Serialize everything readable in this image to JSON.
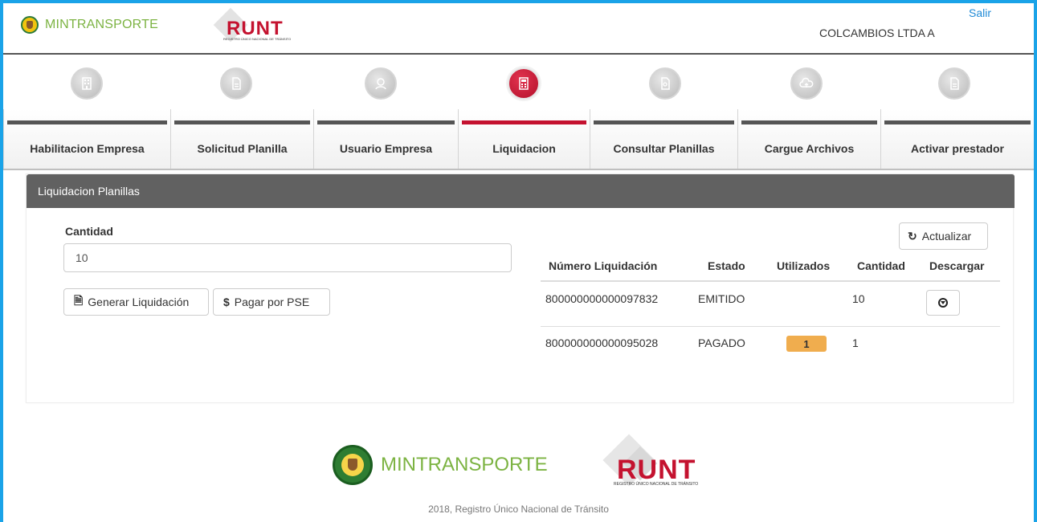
{
  "header": {
    "brand_mintransporte": "MINTRANSPORTE",
    "brand_runt": "RUNT",
    "brand_runt_sub": "REGISTRO ÚNICO NACIONAL DE TRÁNSITO",
    "logout_label": "Salir",
    "company": "COLCAMBIOS LTDA A"
  },
  "nav": {
    "active_index": 3,
    "tabs": [
      {
        "label": "Habilitacion Empresa",
        "icon": "building-icon"
      },
      {
        "label": "Solicitud Planilla",
        "icon": "document-icon"
      },
      {
        "label": "Usuario Empresa",
        "icon": "user-icon"
      },
      {
        "label": "Liquidacion",
        "icon": "calculator-icon"
      },
      {
        "label": "Consultar Planillas",
        "icon": "document-search-icon"
      },
      {
        "label": "Cargue Archivos",
        "icon": "cloud-upload-icon"
      },
      {
        "label": "Activar prestador",
        "icon": "document-icon"
      }
    ]
  },
  "panel": {
    "title": "Liquidacion Planillas",
    "quantity_label": "Cantidad",
    "quantity_value": "10",
    "generate_button": "Generar Liquidación",
    "pay_button": "Pagar por PSE",
    "refresh_button": "Actualizar"
  },
  "table": {
    "headers": [
      "Número Liquidación",
      "Estado",
      "Utilizados",
      "Cantidad",
      "Descargar"
    ],
    "rows": [
      {
        "numero": "800000000000097832",
        "estado": "EMITIDO",
        "utilizados": "",
        "cantidad": "10",
        "descargar": true
      },
      {
        "numero": "800000000000095028",
        "estado": "PAGADO",
        "utilizados": "1",
        "cantidad": "1",
        "descargar": false
      }
    ]
  },
  "footer": {
    "brand_mintransporte": "MINTRANSPORTE",
    "brand_runt": "RUNT",
    "brand_runt_sub": "REGISTRO ÚNICO NACIONAL DE TRÁNSITO",
    "copyright": "2018, Registro Único Nacional de Tránsito"
  },
  "colors": {
    "accent_red": "#c4122f",
    "brand_green": "#7cb342",
    "panel_header": "#616161",
    "badge_orange": "#f0ad4e",
    "link_blue": "#1f8ad6"
  }
}
